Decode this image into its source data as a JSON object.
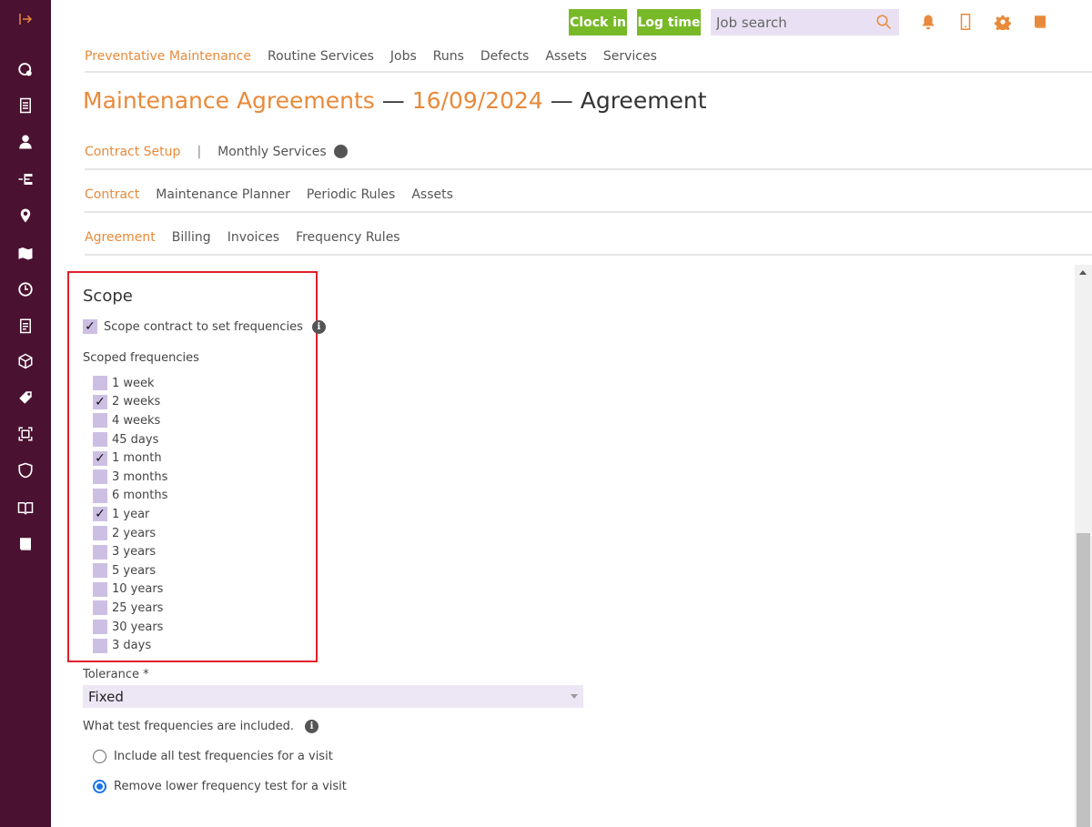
{
  "colors": {
    "sidebar": "#4a1230",
    "accent": "#e88a3a",
    "green": "#78b928",
    "highlight_box": "#e0202a"
  },
  "sidebar": {
    "icons": [
      "collapse-arrow-icon",
      "dashboard-icon",
      "checklist-icon",
      "person-icon",
      "hierarchy-icon",
      "location-pin-icon",
      "map-icon",
      "clock-icon",
      "clipboard-icon",
      "box-icon",
      "tag-icon",
      "scan-icon",
      "shield-icon",
      "book-open-icon",
      "book-icon"
    ]
  },
  "topbar": {
    "clock_in": "Clock in",
    "log_time": "Log time",
    "search_placeholder": "Job search",
    "icons": [
      "bell-icon",
      "phone-icon",
      "gear-icon",
      "book-icon"
    ]
  },
  "main_nav": {
    "items": [
      "Preventative Maintenance",
      "Routine Services",
      "Jobs",
      "Runs",
      "Defects",
      "Assets",
      "Services"
    ],
    "active": "Preventative Maintenance"
  },
  "title": {
    "part1": "Maintenance Agreements",
    "sep1": " — ",
    "date": "16/09/2024",
    "sep2": " — ",
    "part2": "Agreement"
  },
  "tabs1": {
    "items": [
      "Contract Setup",
      "|",
      "Monthly Services"
    ]
  },
  "tabs2": {
    "items": [
      "Contract",
      "Maintenance Planner",
      "Periodic Rules",
      "Assets"
    ]
  },
  "tabs3": {
    "items": [
      "Agreement",
      "Billing",
      "Invoices",
      "Frequency Rules"
    ]
  },
  "scope": {
    "title": "Scope",
    "checkbox_label": "Scope contract to set frequencies",
    "scoped_label": "Scoped frequencies",
    "frequencies": [
      {
        "label": "1 week",
        "checked": false
      },
      {
        "label": "2 weeks",
        "checked": true
      },
      {
        "label": "4 weeks",
        "checked": false
      },
      {
        "label": "45 days",
        "checked": false
      },
      {
        "label": "1 month",
        "checked": true
      },
      {
        "label": "3 months",
        "checked": false
      },
      {
        "label": "6 months",
        "checked": false
      },
      {
        "label": "1 year",
        "checked": true
      },
      {
        "label": "2 years",
        "checked": false
      },
      {
        "label": "3 years",
        "checked": false
      },
      {
        "label": "5 years",
        "checked": false
      },
      {
        "label": "10 years",
        "checked": false
      },
      {
        "label": "25 years",
        "checked": false
      },
      {
        "label": "30 years",
        "checked": false
      },
      {
        "label": "3 days",
        "checked": false
      }
    ]
  },
  "tolerance": {
    "label": "Tolerance *",
    "value": "Fixed"
  },
  "test_freq": {
    "question": "What test frequencies are included.",
    "options": [
      {
        "label": "Include all test frequencies for a visit",
        "selected": false
      },
      {
        "label": "Remove lower frequency test for a visit",
        "selected": true
      }
    ]
  }
}
